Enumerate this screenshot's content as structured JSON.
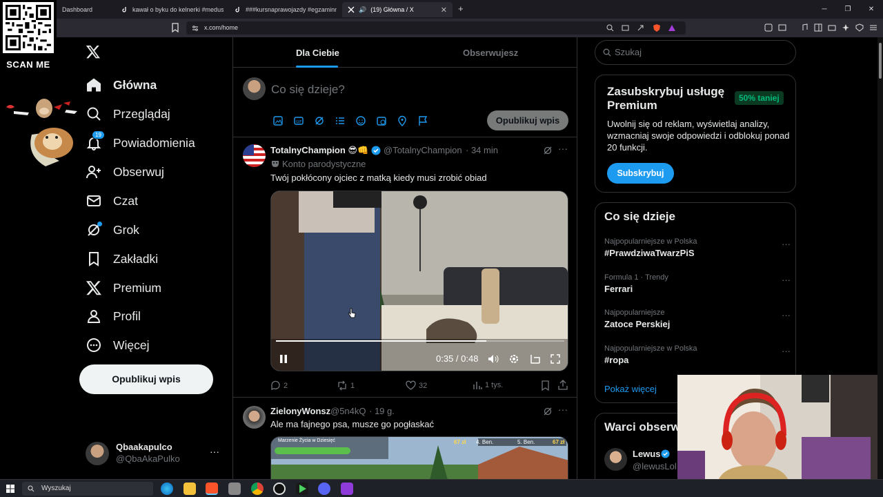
{
  "browser": {
    "tabs": [
      {
        "label": "Dashboard",
        "active": false
      },
      {
        "label": "kawał o byku do kelnerki #medusa #",
        "active": false
      },
      {
        "label": "###kursnaprawojazdy #egzaminnap",
        "active": false
      },
      {
        "label": "(19) Główna / X",
        "active": true
      }
    ],
    "new_tab": "+",
    "url": "x.com/home",
    "window_controls": [
      "─",
      "❐",
      "✕"
    ]
  },
  "overlay": {
    "scan_label": "SCAN ME"
  },
  "nav": {
    "items": [
      {
        "label": "Główna",
        "icon": "home-icon",
        "active": true
      },
      {
        "label": "Przeglądaj",
        "icon": "search-icon"
      },
      {
        "label": "Powiadomienia",
        "icon": "bell-icon",
        "badge": "19"
      },
      {
        "label": "Obserwuj",
        "icon": "follow-icon"
      },
      {
        "label": "Czat",
        "icon": "mail-icon"
      },
      {
        "label": "Grok",
        "icon": "grok-icon"
      },
      {
        "label": "Zakładki",
        "icon": "bookmark-icon"
      },
      {
        "label": "Premium",
        "icon": "x-icon"
      },
      {
        "label": "Profil",
        "icon": "profile-icon"
      },
      {
        "label": "Więcej",
        "icon": "more-circle-icon"
      }
    ],
    "post_button": "Opublikuj wpis",
    "account": {
      "name": "Qbaakapulco",
      "handle": "@QbaAkaPulko",
      "more": "···"
    }
  },
  "timeline": {
    "tabs": [
      "Dla Ciebie",
      "Obserwujesz"
    ],
    "composer": {
      "placeholder": "Co się dzieje?",
      "post_button": "Opublikuj wpis"
    },
    "tweets": [
      {
        "name": "TotalnyChampion 😎👊",
        "handle": "@TotalnyChampion",
        "time": "· 34 min",
        "label": "Konto parodystyczne",
        "text": "Twój pokłócony ojciec z matką kiedy musi zrobić obiad",
        "video": {
          "time": "0:35 / 0:48",
          "progress": 0.73
        },
        "stats": {
          "replies": "2",
          "reposts": "1",
          "likes": "32",
          "views": "1 tys."
        }
      },
      {
        "name": "ZielonyWonsz",
        "handle": "@5n4kQ",
        "time": "· 19 g.",
        "text": "Ale ma fajnego psa, musze go pogłaskać",
        "overlay_texts": [
          "Marzenie Życia w Dziesięć",
          "67 zł",
          "4. Ben.",
          "5. Ben.",
          "67 zł"
        ]
      }
    ]
  },
  "sidebar": {
    "search_placeholder": "Szukaj",
    "premium": {
      "title": "Zasubskrybuj usługę Premium",
      "badge": "50% taniej",
      "description": "Uwolnij się od reklam, wyświetlaj analizy, wzmacniaj swoje odpowiedzi i odblokuj ponad 20 funkcji.",
      "button": "Subskrybuj"
    },
    "trends": {
      "title": "Co się dzieje",
      "items": [
        {
          "category": "Najpopularniejsze w Polska",
          "name": "#PrawdziwaTwarzPiS"
        },
        {
          "category": "Formula 1 · Trendy",
          "name": "Ferrari"
        },
        {
          "category": "Najpopularniejsze",
          "name": "Zatoce Perskiej"
        },
        {
          "category": "Najpopularniejsze w Polska",
          "name": "#ropa"
        }
      ],
      "show_more": "Pokaż więcej"
    },
    "who_to_follow": {
      "title": "Warci obserw",
      "user": {
        "name": "Lewus",
        "handle": "@lewusLol"
      }
    }
  },
  "taskbar": {
    "search": "Wyszukaj"
  },
  "colors": {
    "accent": "#1d9bf0",
    "background": "#000000",
    "border": "#2f3336",
    "muted": "#71767b",
    "green": "#00ba7c"
  }
}
